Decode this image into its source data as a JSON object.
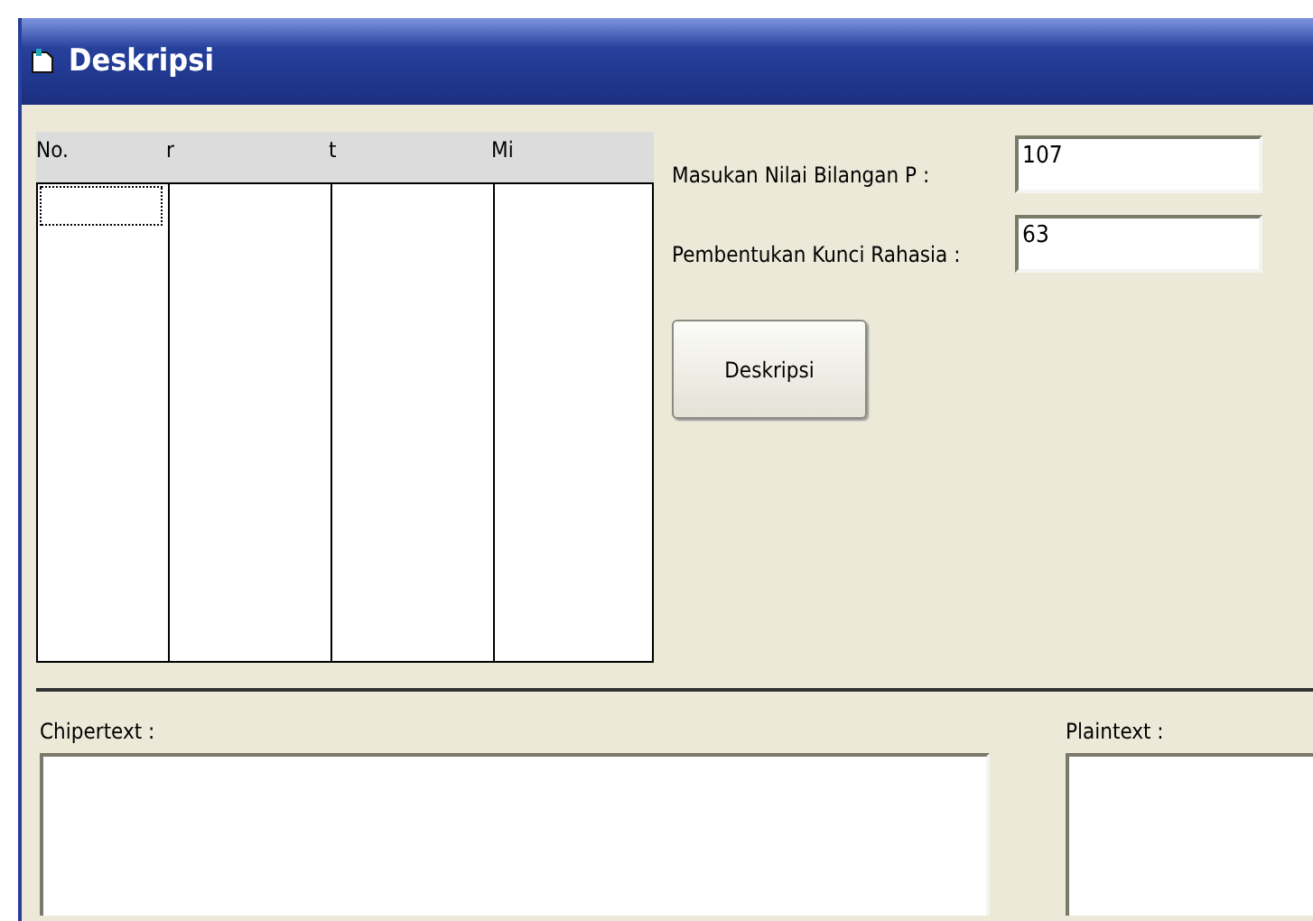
{
  "window": {
    "title": "Deskripsi"
  },
  "grid": {
    "columns": [
      "No.",
      "r",
      "t",
      "Mi"
    ],
    "first_cell_focused": true
  },
  "fields": [
    {
      "label": "Masukan Nilai Bilangan P :",
      "value": "107"
    },
    {
      "label": "Pembentukan Kunci Rahasia :",
      "value": "63"
    }
  ],
  "button": {
    "label": "Deskripsi"
  },
  "outputs": [
    {
      "label": "Chipertext :"
    },
    {
      "label": "Plaintext :"
    }
  ]
}
